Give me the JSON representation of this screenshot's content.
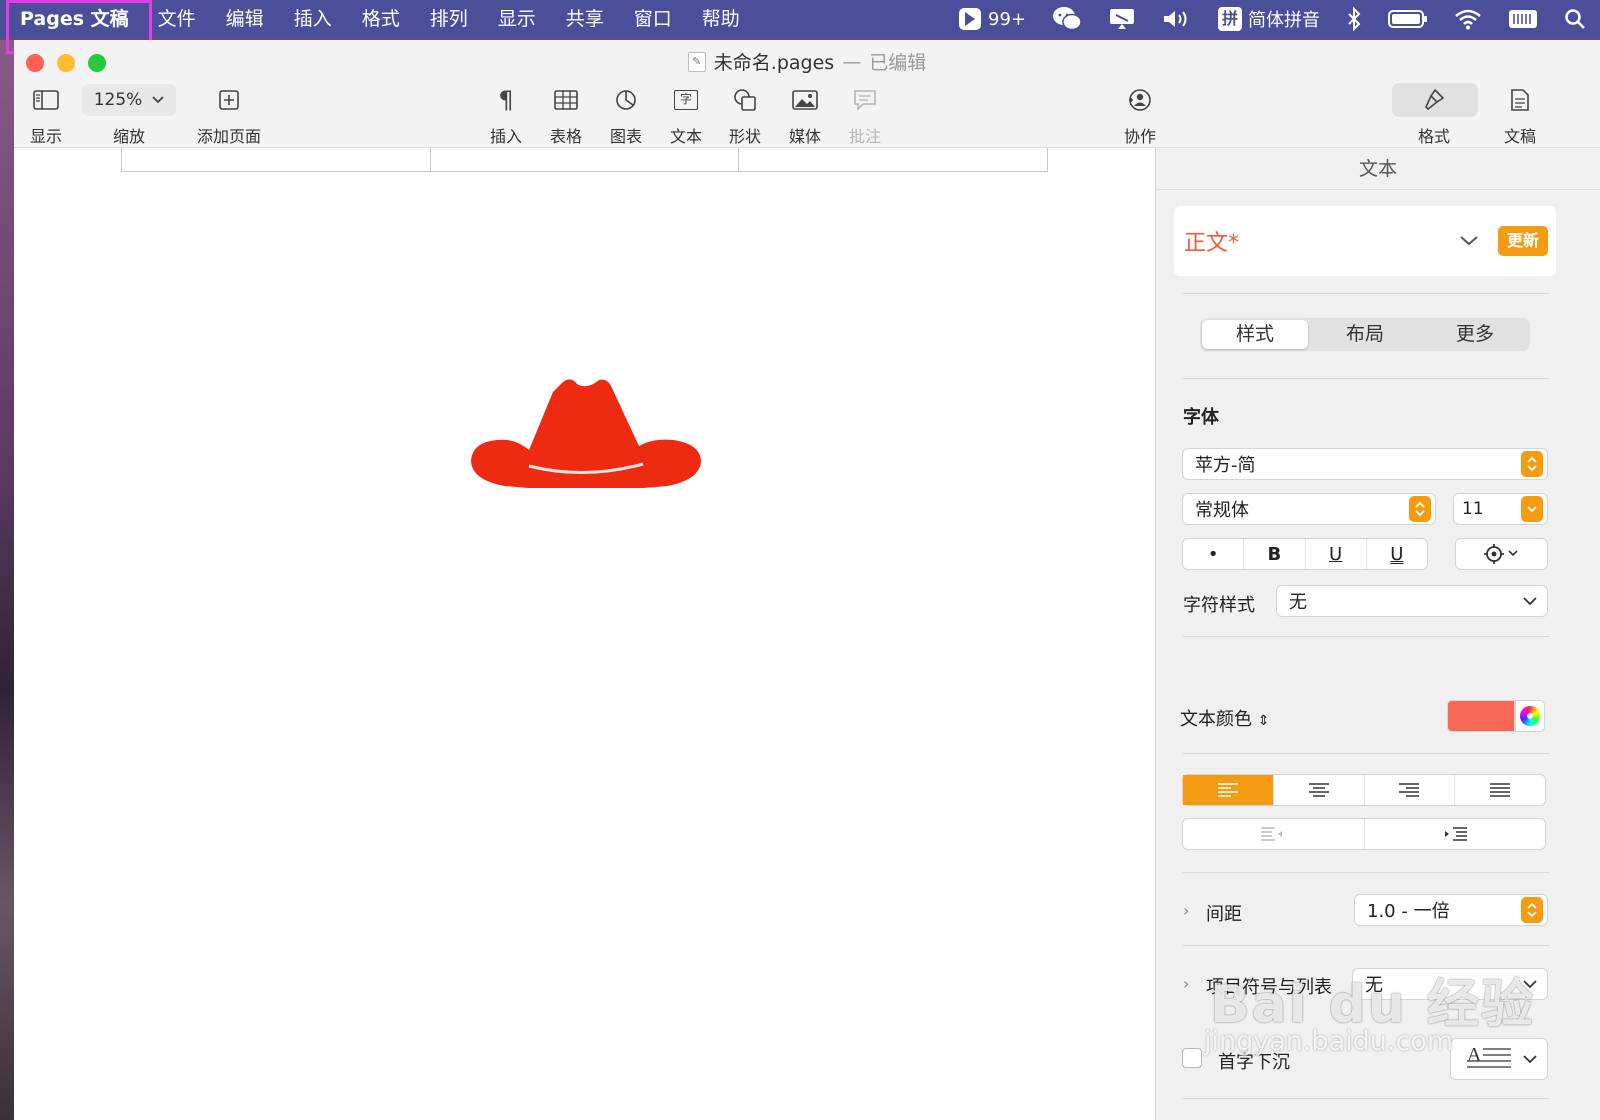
{
  "menubar": {
    "app_name": "Pages 文稿",
    "items": [
      "文件",
      "编辑",
      "插入",
      "格式",
      "排列",
      "显示",
      "共享",
      "窗口",
      "帮助"
    ],
    "notification_count": "99+",
    "input_method": "简体拼音",
    "input_method_badge": "拼"
  },
  "window": {
    "title": "未命名.pages",
    "title_separator": "—",
    "title_status": "已编辑"
  },
  "toolbar": {
    "view_label": "显示",
    "zoom_value": "125%",
    "zoom_label": "缩放",
    "add_page_label": "添加页面",
    "insert_label": "插入",
    "table_label": "表格",
    "chart_label": "图表",
    "text_label": "文本",
    "text_icon_char": "字",
    "shape_label": "形状",
    "media_label": "媒体",
    "comment_label": "批注",
    "collaborate_label": "协作",
    "format_label": "格式",
    "document_label": "文稿"
  },
  "document": {
    "hat_color": "#ee2a10"
  },
  "inspector": {
    "header": "文本",
    "paragraph_style": "正文*",
    "update_button": "更新",
    "tabs": [
      "样式",
      "布局",
      "更多"
    ],
    "active_tab": "样式",
    "font_section": "字体",
    "font_family": "苹方-简",
    "font_weight": "常规体",
    "font_size": "11",
    "style_buttons": {
      "bullet": "•",
      "bold": "B",
      "underline": "U",
      "double_underline": "U"
    },
    "char_style_label": "字符样式",
    "char_style_value": "无",
    "text_color_label": "文本颜色",
    "text_color": "#f76755",
    "alignment_active": "left",
    "spacing_label": "间距",
    "spacing_value": "1.0 - 一倍",
    "bullets_label": "项目符号与列表",
    "bullets_value": "无",
    "drop_cap_label": "首字下沉"
  },
  "watermark": {
    "brand": "Bai du 经验",
    "url": "jingyan.baidu.com"
  },
  "colors": {
    "accent": "#f49b12",
    "menubar": "#4b4f9a",
    "highlight": "#e23de6"
  }
}
